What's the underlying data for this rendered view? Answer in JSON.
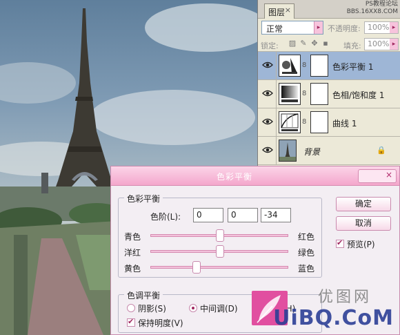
{
  "layers_panel": {
    "tab_label": "图层",
    "tab_close": "×",
    "watermark_line1": "PS教程论坛",
    "watermark_line2": "BBS.16XX8.COM",
    "blend_mode": "正常",
    "opacity_label": "不透明度:",
    "opacity_value": "100%",
    "lock_label": "锁定:",
    "fill_label": "填充:",
    "fill_value": "100%",
    "layers": [
      {
        "name": "色彩平衡 1",
        "type": "adjustment",
        "selected": true
      },
      {
        "name": "色相/饱和度 1",
        "type": "adjustment",
        "selected": false
      },
      {
        "name": "曲线 1",
        "type": "adjustment",
        "selected": false
      },
      {
        "name": "背景",
        "type": "background",
        "selected": false
      }
    ]
  },
  "dialog": {
    "title": "色彩平衡",
    "close_glyph": "×",
    "color_balance_group": "色彩平衡",
    "levels_label": "色阶(L):",
    "levels": [
      "0",
      "0",
      "-34"
    ],
    "sliders": [
      {
        "left": "青色",
        "right": "红色",
        "value": 0
      },
      {
        "left": "洋红",
        "right": "绿色",
        "value": 0
      },
      {
        "left": "黄色",
        "right": "蓝色",
        "value": -34
      }
    ],
    "ok_label": "确定",
    "cancel_label": "取消",
    "preview_label": "预览(P)",
    "preview_checked": true,
    "tone_group": "色调平衡",
    "tones": [
      {
        "label": "阴影(S)",
        "selected": false
      },
      {
        "label": "中间调(D)",
        "selected": true
      },
      {
        "label": "高光(H)",
        "selected": false
      }
    ],
    "preserve_label": "保持明度(V)",
    "preserve_checked": true
  },
  "branding": {
    "logo_text": "UiBQ.CoM",
    "logo_cn": "优图网"
  },
  "colors": {
    "accent_pink": "#f4a7cc",
    "selected_layer": "#9eb6d6",
    "logo_blue": "#2d3f96"
  }
}
